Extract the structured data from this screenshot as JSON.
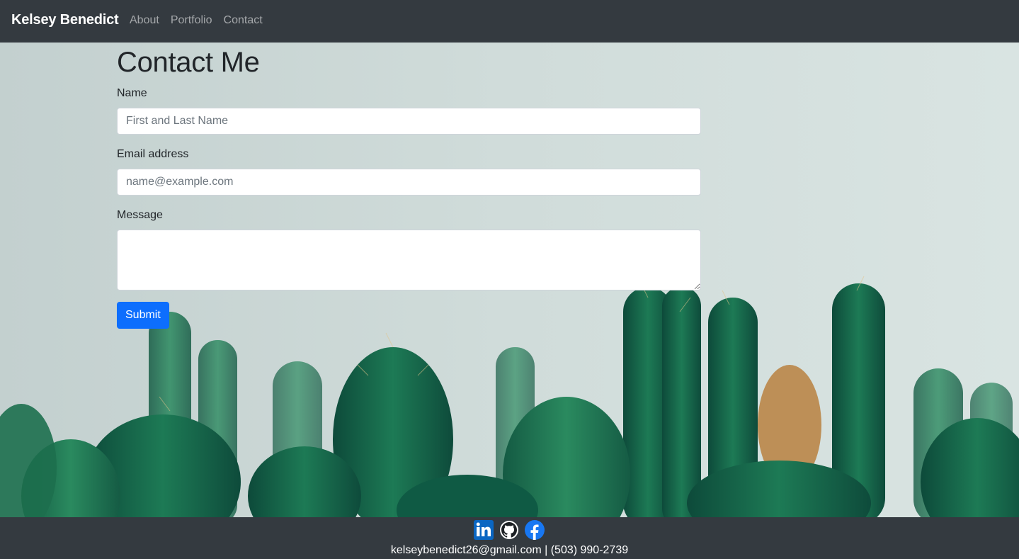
{
  "nav": {
    "brand": "Kelsey Benedict",
    "links": [
      "About",
      "Portfolio",
      "Contact"
    ]
  },
  "page": {
    "title": "Contact Me"
  },
  "form": {
    "name_label": "Name",
    "name_placeholder": "First and Last Name",
    "email_label": "Email address",
    "email_placeholder": "name@example.com",
    "message_label": "Message",
    "message_value": "",
    "submit_label": "Submit"
  },
  "footer": {
    "icons": [
      "linkedin-icon",
      "github-icon",
      "facebook-icon"
    ],
    "contact_line": "kelseybenedict26@gmail.com | (503) 990-2739"
  },
  "colors": {
    "navbar": "#343a40",
    "primary_button": "#0d6efd",
    "linkedin": "#0a66c2",
    "facebook": "#1877f2"
  }
}
